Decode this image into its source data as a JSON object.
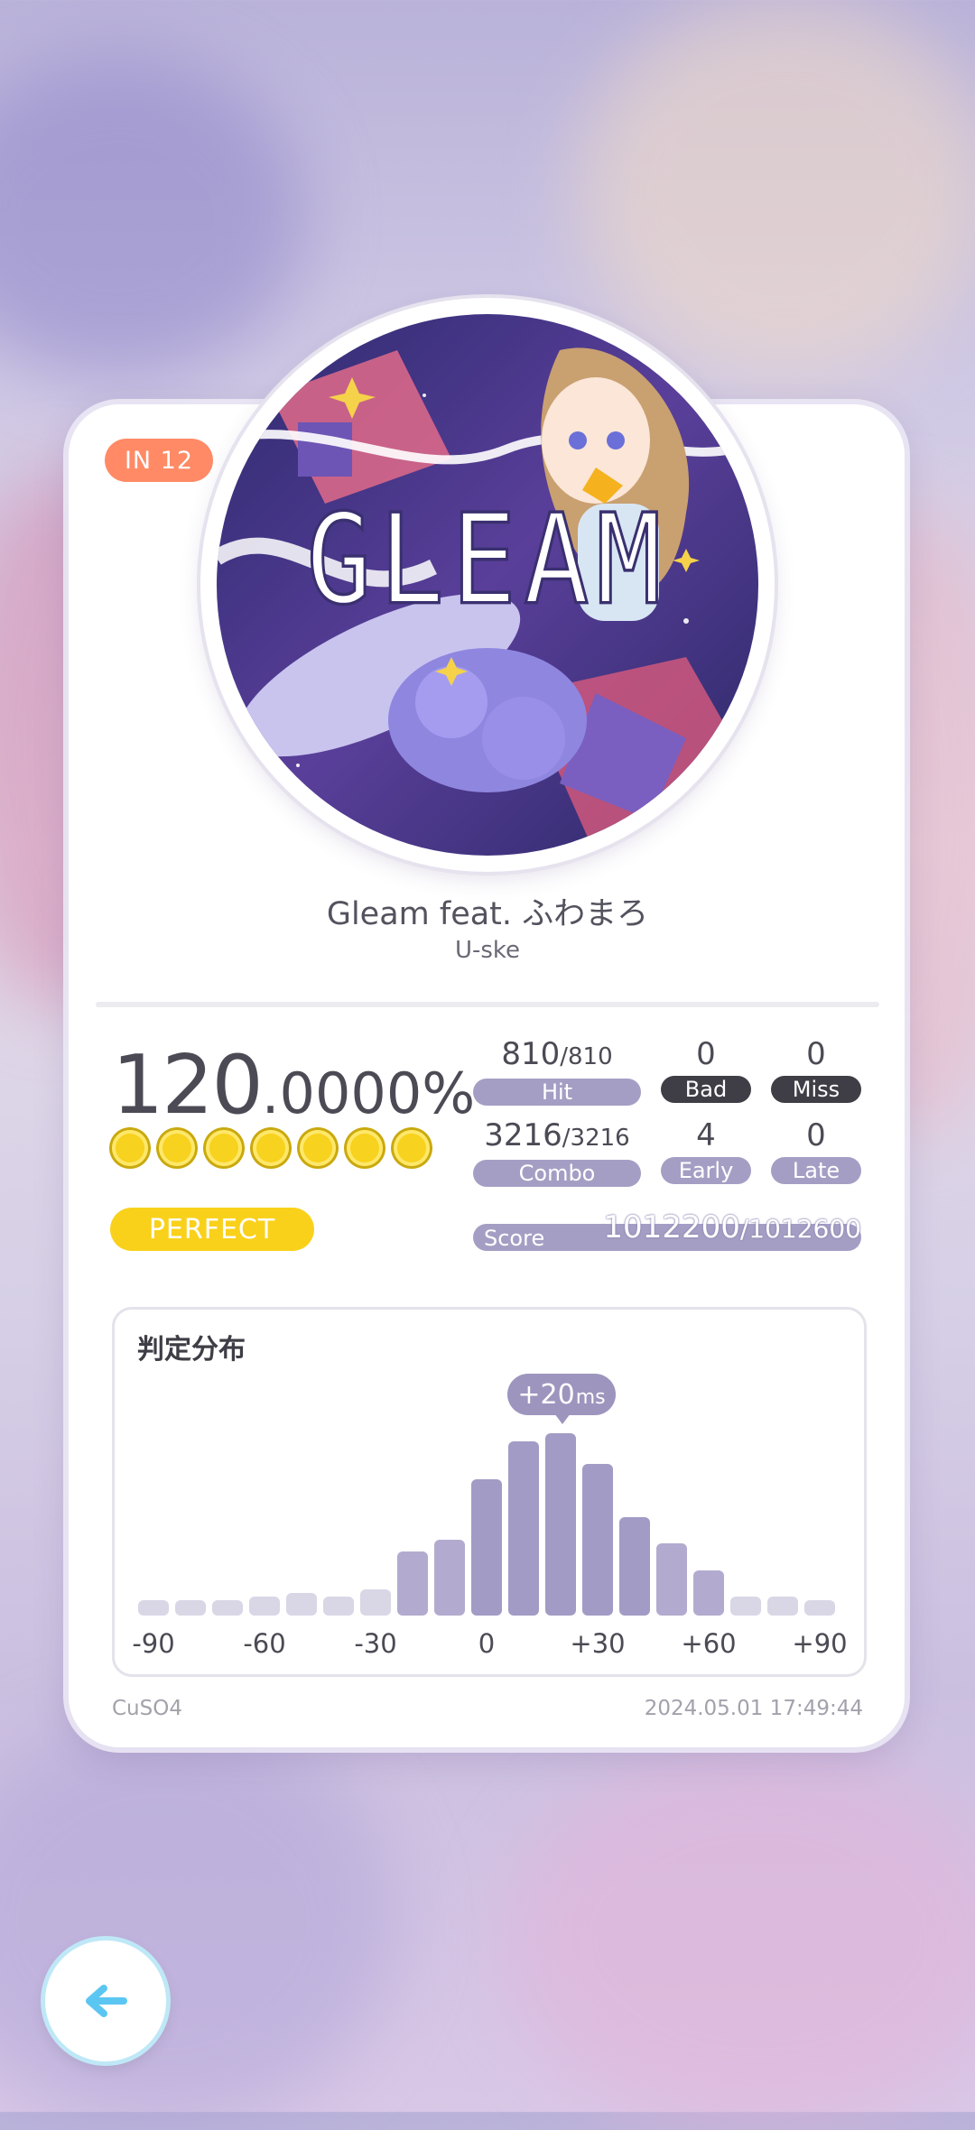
{
  "level": "IN  12",
  "song": {
    "title": "Gleam feat. ふわまろ",
    "artist": "U-ske",
    "jacket_text": "GLEAM"
  },
  "accuracy": {
    "integer": "120",
    "decimal": ".0000%"
  },
  "stars_count": 7,
  "grade": "PERFECT",
  "stats": {
    "hit": {
      "value": "810",
      "total": "/810",
      "label": "Hit"
    },
    "bad": {
      "value": "0",
      "label": "Bad"
    },
    "miss": {
      "value": "0",
      "label": "Miss"
    },
    "combo": {
      "value": "3216",
      "total": "/3216",
      "label": "Combo"
    },
    "early": {
      "value": "4",
      "label": "Early"
    },
    "late": {
      "value": "0",
      "label": "Late"
    }
  },
  "score": {
    "label": "Score",
    "value": "1012200",
    "max": "/1012600"
  },
  "distribution": {
    "title": "判定分布",
    "offset_value": "+20",
    "offset_unit": "ms"
  },
  "chart_data": {
    "type": "bar",
    "x": [
      -90,
      -80,
      -70,
      -60,
      -50,
      -40,
      -30,
      -20,
      -10,
      0,
      10,
      20,
      30,
      40,
      50,
      60,
      70,
      80,
      90
    ],
    "values": [
      4,
      4,
      4,
      5,
      6,
      5,
      7,
      17,
      20,
      36,
      46,
      48,
      40,
      26,
      19,
      12,
      5,
      5,
      4
    ],
    "highlight_x": 20,
    "tick_labels": [
      "-90",
      "-60",
      "-30",
      "0",
      "+30",
      "+60",
      "+90"
    ],
    "tick_values": [
      -90,
      -60,
      -30,
      0,
      30,
      60,
      90
    ],
    "ylim": [
      0,
      50
    ],
    "grid": false
  },
  "footer": {
    "player": "CuSO4",
    "datetime": "2024.05.01 17:49:44"
  },
  "colors": {
    "accent": "#a59ec4",
    "gold": "#f9d11a",
    "level": "#ff8a65"
  }
}
